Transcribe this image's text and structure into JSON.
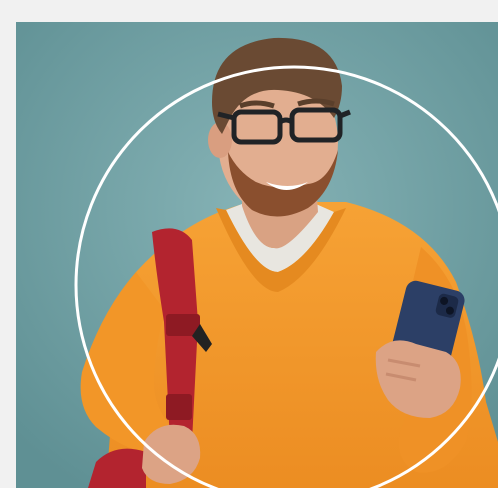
{
  "hero": {
    "subject": "man-with-phone",
    "colors": {
      "background": "#f1f1f1",
      "panel": "#6f9fa3",
      "sweater": "#f39a2c",
      "strap": "#b3242f",
      "ring": "#ffffff",
      "phone": "#2c3f66"
    }
  }
}
